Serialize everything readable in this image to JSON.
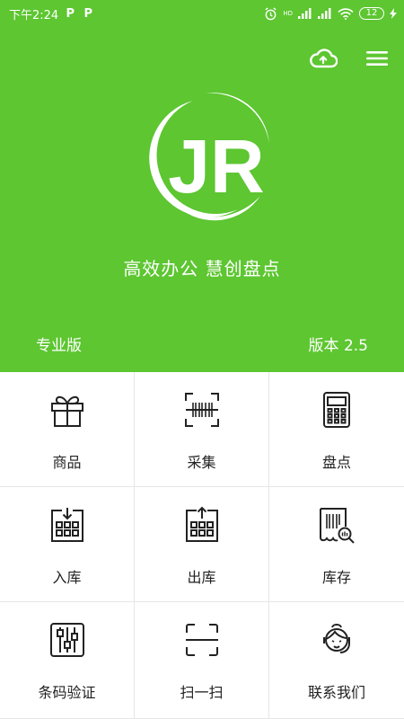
{
  "statusbar": {
    "time": "下午2:24",
    "left_icons": [
      "P",
      "P"
    ],
    "hd_label": "HD",
    "battery": "12"
  },
  "header": {
    "upload_icon": "cloud-upload-icon",
    "menu_icon": "menu-icon"
  },
  "logo_text": "JR",
  "slogan": "高效办公 慧创盘点",
  "edition": "专业版",
  "version": "版本 2.5",
  "colors": {
    "brand": "#5dc631",
    "text": "#222222",
    "divider": "#e6e6e6"
  },
  "grid": [
    {
      "label": "商品",
      "icon": "gift-icon"
    },
    {
      "label": "采集",
      "icon": "barcode-scan-icon"
    },
    {
      "label": "盘点",
      "icon": "calculator-icon"
    },
    {
      "label": "入库",
      "icon": "inbound-icon"
    },
    {
      "label": "出库",
      "icon": "outbound-icon"
    },
    {
      "label": "库存",
      "icon": "inventory-receipt-icon"
    },
    {
      "label": "条码验证",
      "icon": "sliders-icon"
    },
    {
      "label": "扫一扫",
      "icon": "scan-frame-icon"
    },
    {
      "label": "联系我们",
      "icon": "customer-service-icon"
    }
  ]
}
